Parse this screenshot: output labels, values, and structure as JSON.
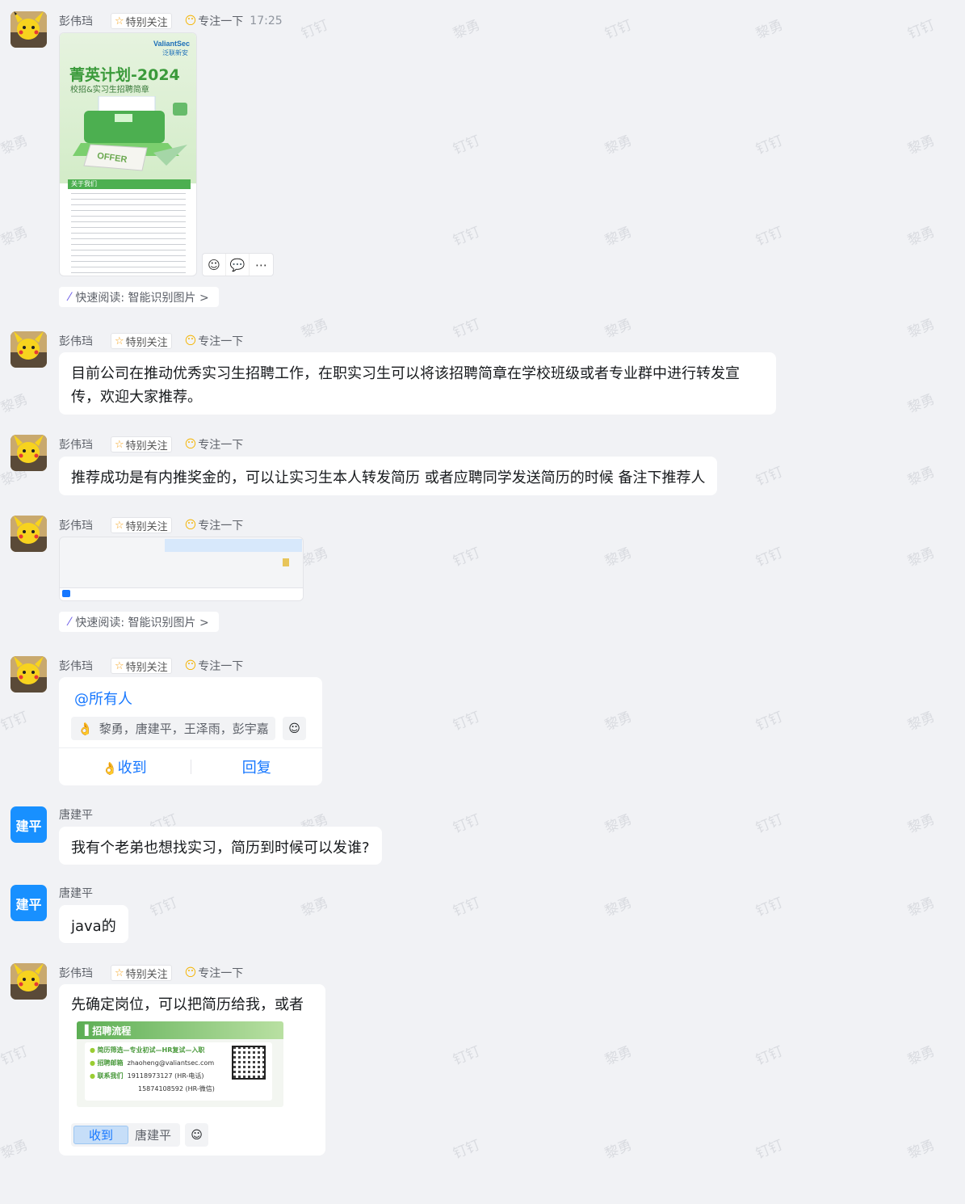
{
  "watermarks": [
    "钉钉",
    "黎勇"
  ],
  "sender_main": "彭伟珰",
  "sender_other": "唐建平",
  "other_avatar_text": "建平",
  "tag_special": "特别关注",
  "status_text": "专注一下",
  "first_time": "17:25",
  "quick_read": "快速阅读: 智能识别图片 >",
  "poster": {
    "brand": "ValiantSec",
    "brand_cn": "泛联新安",
    "title": "菁英计划-2024",
    "subtitle": "校招&实习生招聘简章",
    "offer": "OFFER",
    "section": "关于我们"
  },
  "msg2_text": "目前公司在推动优秀实习生招聘工作，在职实习生可以将该招聘简章在学校班级或者专业群中进行转发宣传，欢迎大家推荐。",
  "msg3_text": "推荐成功是有内推奖金的，可以让实习生本人转发简历 或者应聘同学发送简历的时候 备注下推荐人",
  "ding": {
    "at": "@所有人",
    "readers": "黎勇，唐建平，王泽雨，彭宇嘉",
    "received": "收到",
    "reply": "回复"
  },
  "msg6_text": "我有个老弟也想找实习，简历到时候可以发谁?",
  "msg7_text": "java的",
  "msg8_text": "先确定岗位，可以把简历给我，或者",
  "recruit": {
    "title": "招聘流程",
    "line1_label": "简历筛选—专业初试—HR复试—入职",
    "line2_label": "招聘邮箱",
    "line2_value": "zhaoheng@valiantsec.com",
    "line3_label": "联系我们",
    "line3_value": "19118973127 (HR-电话)",
    "line4_value": "15874108592 (HR-微信)"
  },
  "reply_got": "收到",
  "reply_who": "唐建平"
}
